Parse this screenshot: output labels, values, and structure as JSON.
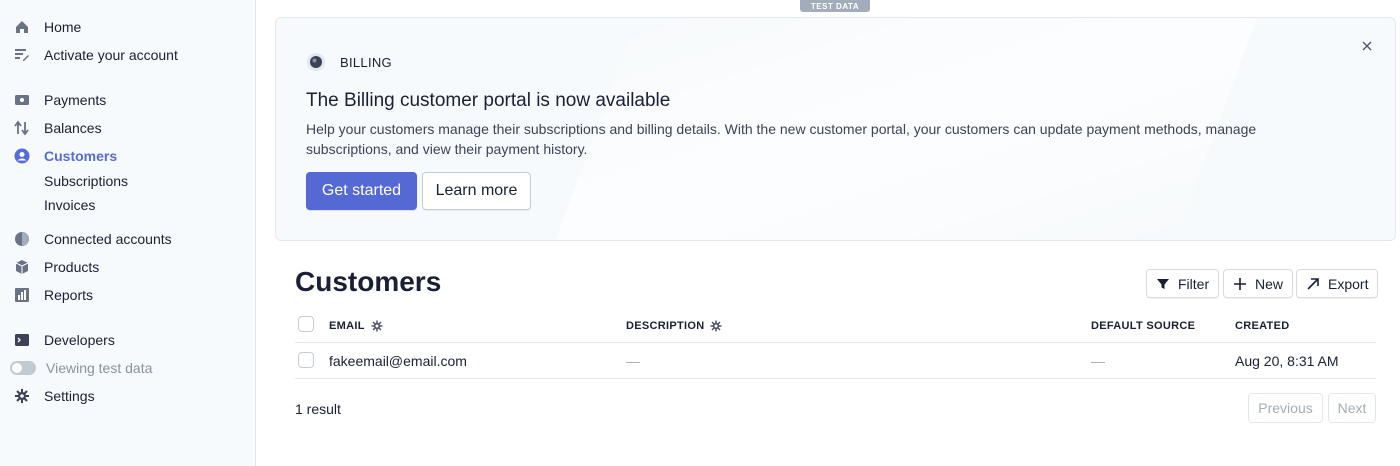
{
  "sidebar": {
    "items": [
      {
        "label": "Home",
        "icon": "home-icon"
      },
      {
        "label": "Activate your account",
        "icon": "activate-icon"
      },
      {
        "label": "Payments",
        "icon": "payments-icon"
      },
      {
        "label": "Balances",
        "icon": "balances-icon"
      },
      {
        "label": "Customers",
        "icon": "customers-icon",
        "active": true
      },
      {
        "label": "Connected accounts",
        "icon": "connected-accounts-icon"
      },
      {
        "label": "Products",
        "icon": "products-icon"
      },
      {
        "label": "Reports",
        "icon": "reports-icon"
      },
      {
        "label": "Developers",
        "icon": "developers-icon"
      },
      {
        "label": "Viewing test data",
        "icon": "toggle-icon"
      },
      {
        "label": "Settings",
        "icon": "gear-icon"
      }
    ],
    "subitems": [
      {
        "label": "Subscriptions"
      },
      {
        "label": "Invoices"
      }
    ]
  },
  "test_badge": "TEST DATA",
  "banner": {
    "eyebrow": "BILLING",
    "title": "The Billing customer portal is now available",
    "description": "Help your customers manage their subscriptions and billing details. With the new customer portal, your customers can update payment methods, manage subscriptions, and view their payment history.",
    "primary_label": "Get started",
    "secondary_label": "Learn more"
  },
  "customers": {
    "title": "Customers",
    "actions": {
      "filter": "Filter",
      "new": "New",
      "export": "Export"
    },
    "columns": [
      "EMAIL",
      "DESCRIPTION",
      "DEFAULT SOURCE",
      "CREATED"
    ],
    "rows": [
      {
        "email": "fakeemail@email.com",
        "description": "—",
        "default_source": "—",
        "created": "Aug 20, 8:31 AM"
      }
    ],
    "result_count": "1 result",
    "pagination": {
      "previous": "Previous",
      "next": "Next"
    }
  },
  "colors": {
    "accent": "#5469d4",
    "active_nav": "#556cd6",
    "badge": "#a3acb9"
  }
}
